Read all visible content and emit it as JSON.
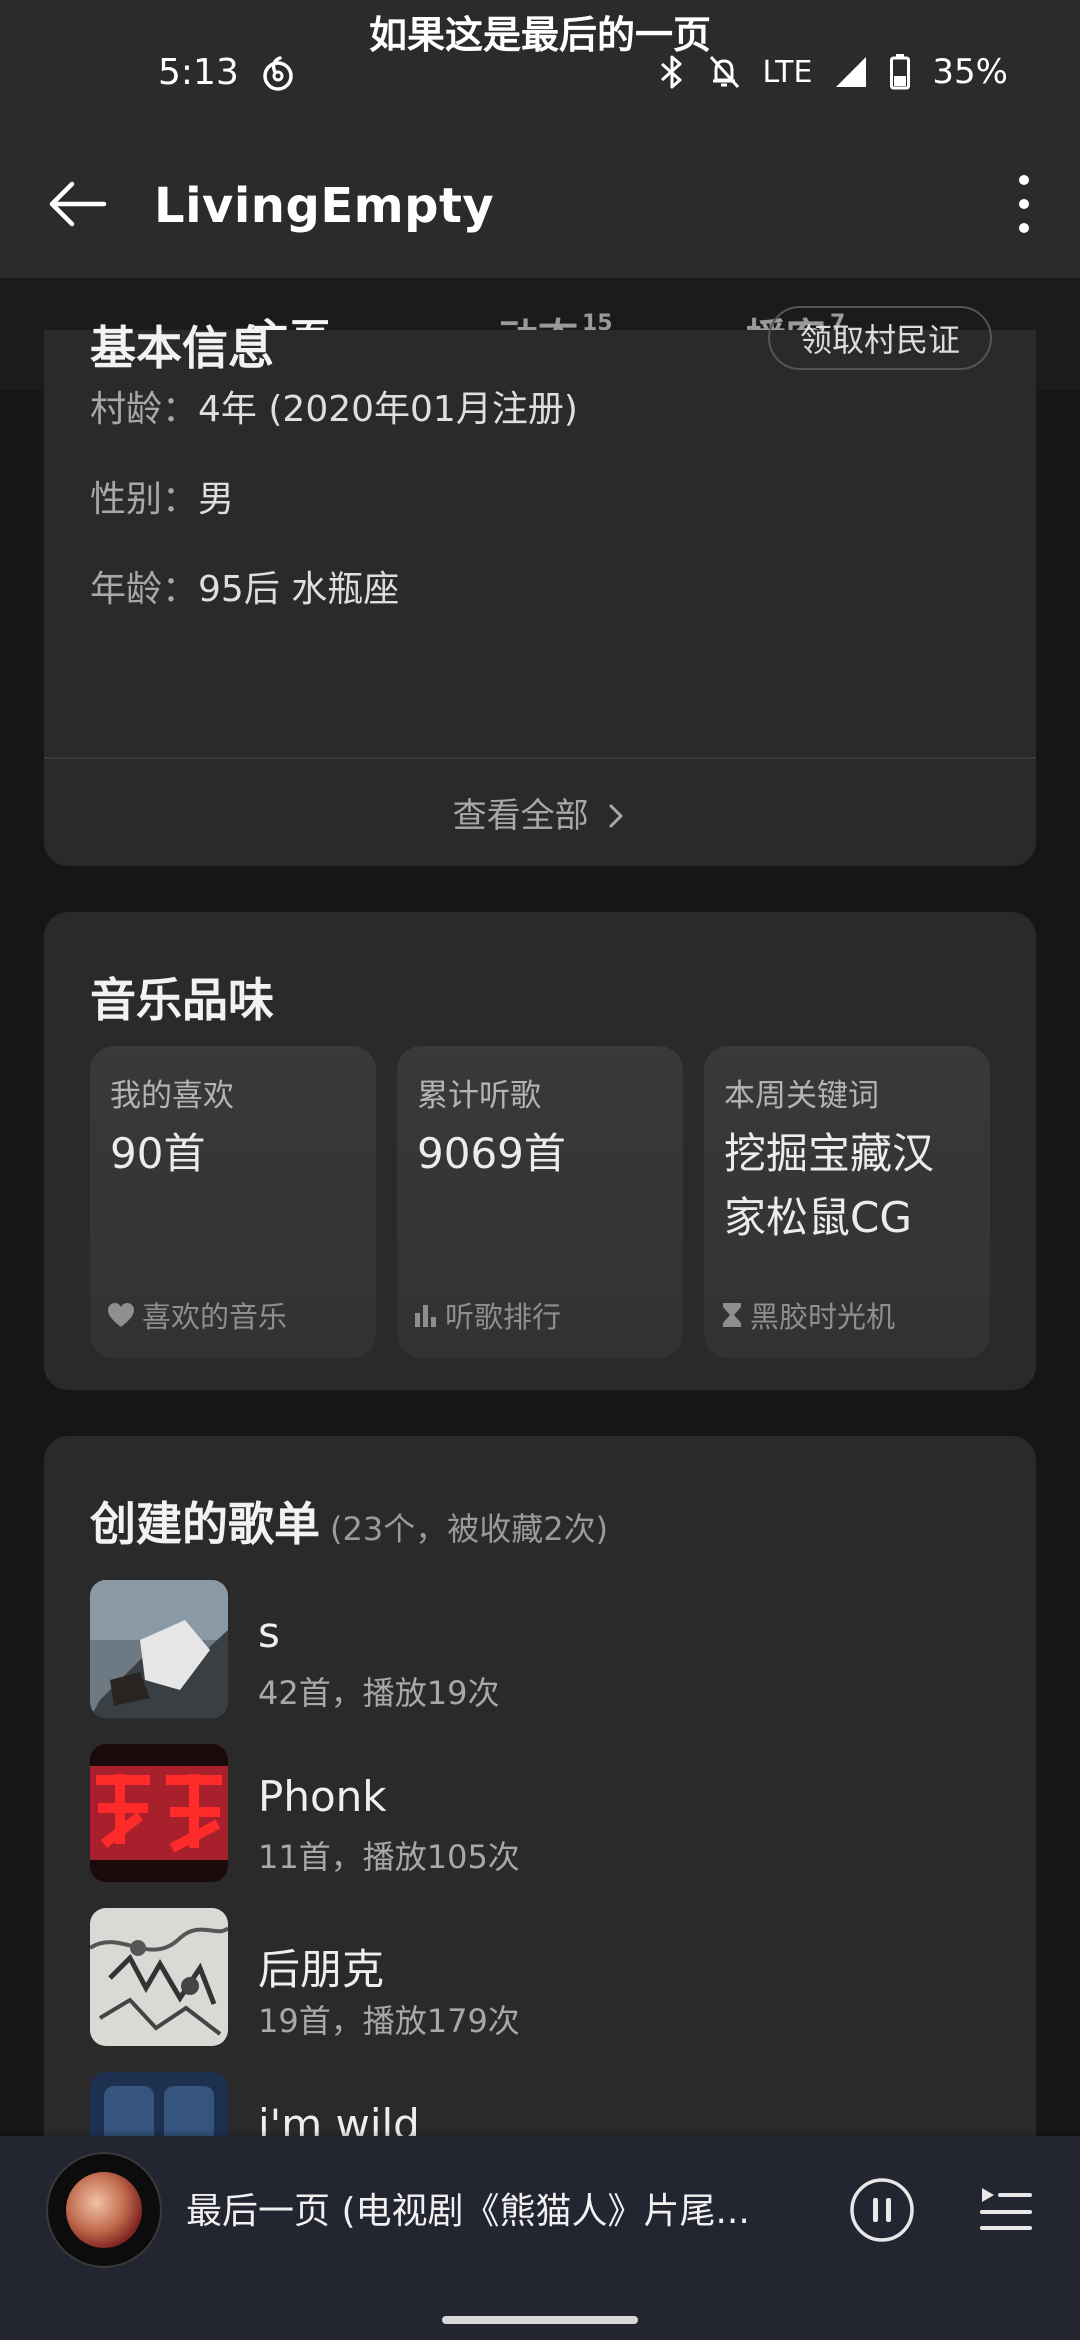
{
  "status_bar": {
    "lyric_banner": "如果这是最后的一页",
    "time": "5:13",
    "network": "LTE",
    "battery": "35%"
  },
  "app_bar": {
    "title": "LivingEmpty"
  },
  "tabs": [
    {
      "label": "主页",
      "badge": ""
    },
    {
      "label": "动态",
      "badge": "15"
    },
    {
      "label": "播客",
      "badge": "7"
    }
  ],
  "basic_info": {
    "title": "基本信息",
    "village_button": "领取村民证",
    "rows": [
      {
        "key": "村龄：",
        "value": "4年 (2020年01月注册)"
      },
      {
        "key": "性别：",
        "value": "男"
      },
      {
        "key": "年龄：",
        "value": "95后 水瓶座"
      }
    ],
    "view_all": "查看全部"
  },
  "music_taste": {
    "title": "音乐品味",
    "cards": [
      {
        "label": "我的喜欢",
        "value": "90首",
        "footer": "喜欢的音乐",
        "icon": "heart-icon"
      },
      {
        "label": "累计听歌",
        "value": "9069首",
        "footer": "听歌排行",
        "icon": "bar-chart-icon"
      },
      {
        "label": "本周关键词",
        "value": "挖掘宝藏汉家松鼠CG",
        "footer": "黑胶时光机",
        "icon": "hourglass-icon"
      }
    ]
  },
  "playlists": {
    "title": "创建的歌单",
    "subtitle": "(23个，被收藏2次)",
    "items": [
      {
        "name": "s",
        "meta": "42首，播放19次"
      },
      {
        "name": "Phonk",
        "meta": "11首，播放105次"
      },
      {
        "name": "后朋克",
        "meta": "19首，播放179次"
      },
      {
        "name": "i'm wild",
        "meta": ""
      }
    ]
  },
  "player": {
    "song_title": "最后一页 (电视剧《熊猫人》片尾..."
  },
  "colors": {
    "accent": "#f0283c",
    "background": "#161616",
    "card": "#2a2a2a",
    "bar": "#2b2b2b"
  }
}
